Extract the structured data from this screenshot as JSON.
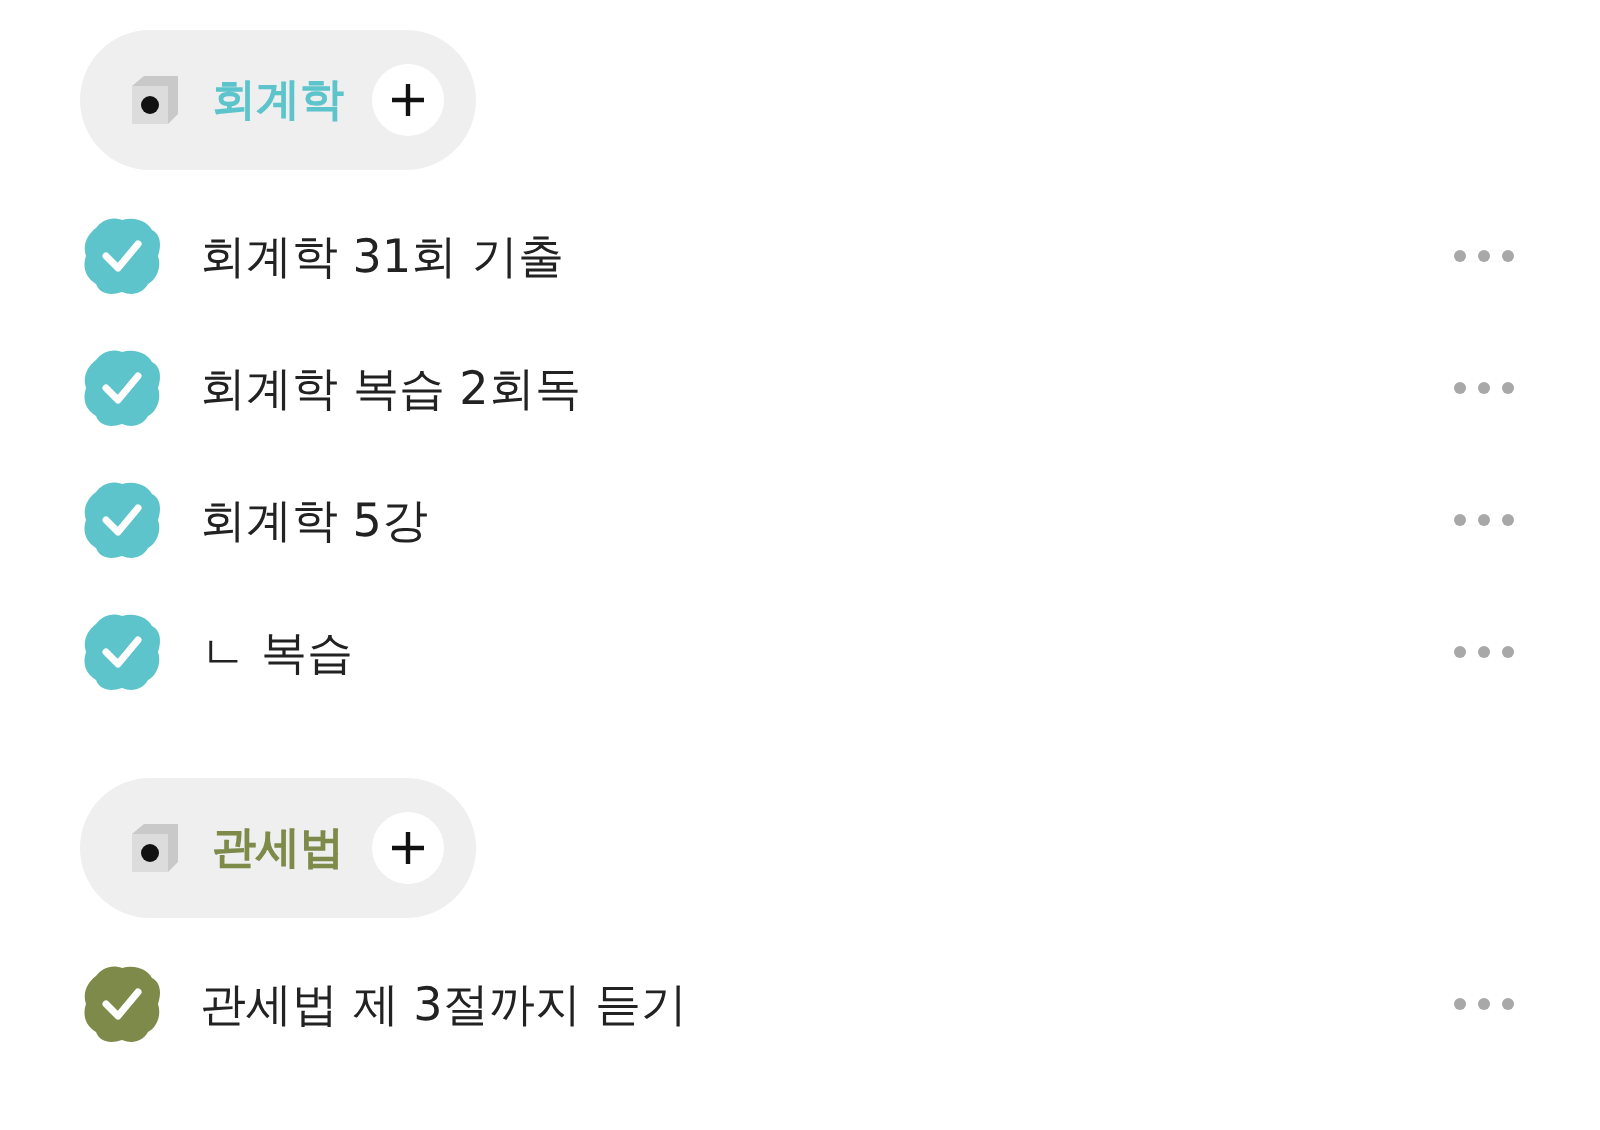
{
  "categories": [
    {
      "name": "회계학",
      "color": "#5ec4cc",
      "items": [
        {
          "title": "회계학 31회 기출",
          "checked": true
        },
        {
          "title": "회계학 복습 2회독",
          "checked": true
        },
        {
          "title": "회계학 5강",
          "checked": true
        },
        {
          "title": "ㄴ 복습",
          "checked": true
        }
      ]
    },
    {
      "name": "관세법",
      "color": "#7e8a4a",
      "items": [
        {
          "title": "관세법 제 3절까지 듣기",
          "checked": true
        }
      ]
    }
  ]
}
